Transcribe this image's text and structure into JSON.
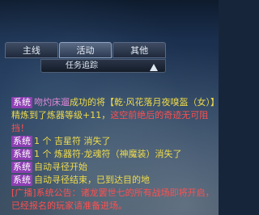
{
  "tabs": {
    "main": "主线",
    "activity": "活动",
    "other": "其他"
  },
  "quest_tracker": {
    "label": "任务追踪"
  },
  "chat": {
    "system_tag": "系统",
    "announce_tag": "[广播]",
    "lines": {
      "l1_name": "吻灼床遛",
      "l1_text_a": "成功的将【乾·风花落月夜嗅盔（女）】精炼到了炼器等级+11，",
      "l1_text_b": "这空前绝后的奇迹无可阻挡！",
      "l2_text": "1 个 吉星符 消失了",
      "l3_text": "1 个 炼器符·龙魂符（神魔装）消失了",
      "l4_text": "自动寻径开始",
      "l5_text": "自动寻径结束，已到达目的地",
      "l6_text": "系统公告：诸龙罢世七的所有战场即将开启，已经报名的玩家请准备进场。"
    }
  },
  "colors": {
    "system_tag_bg": "#8e3fb3",
    "player_name": "#e08ad8",
    "highlight_yellow": "#f0dc4a",
    "announcement_red": "#ff5050"
  }
}
